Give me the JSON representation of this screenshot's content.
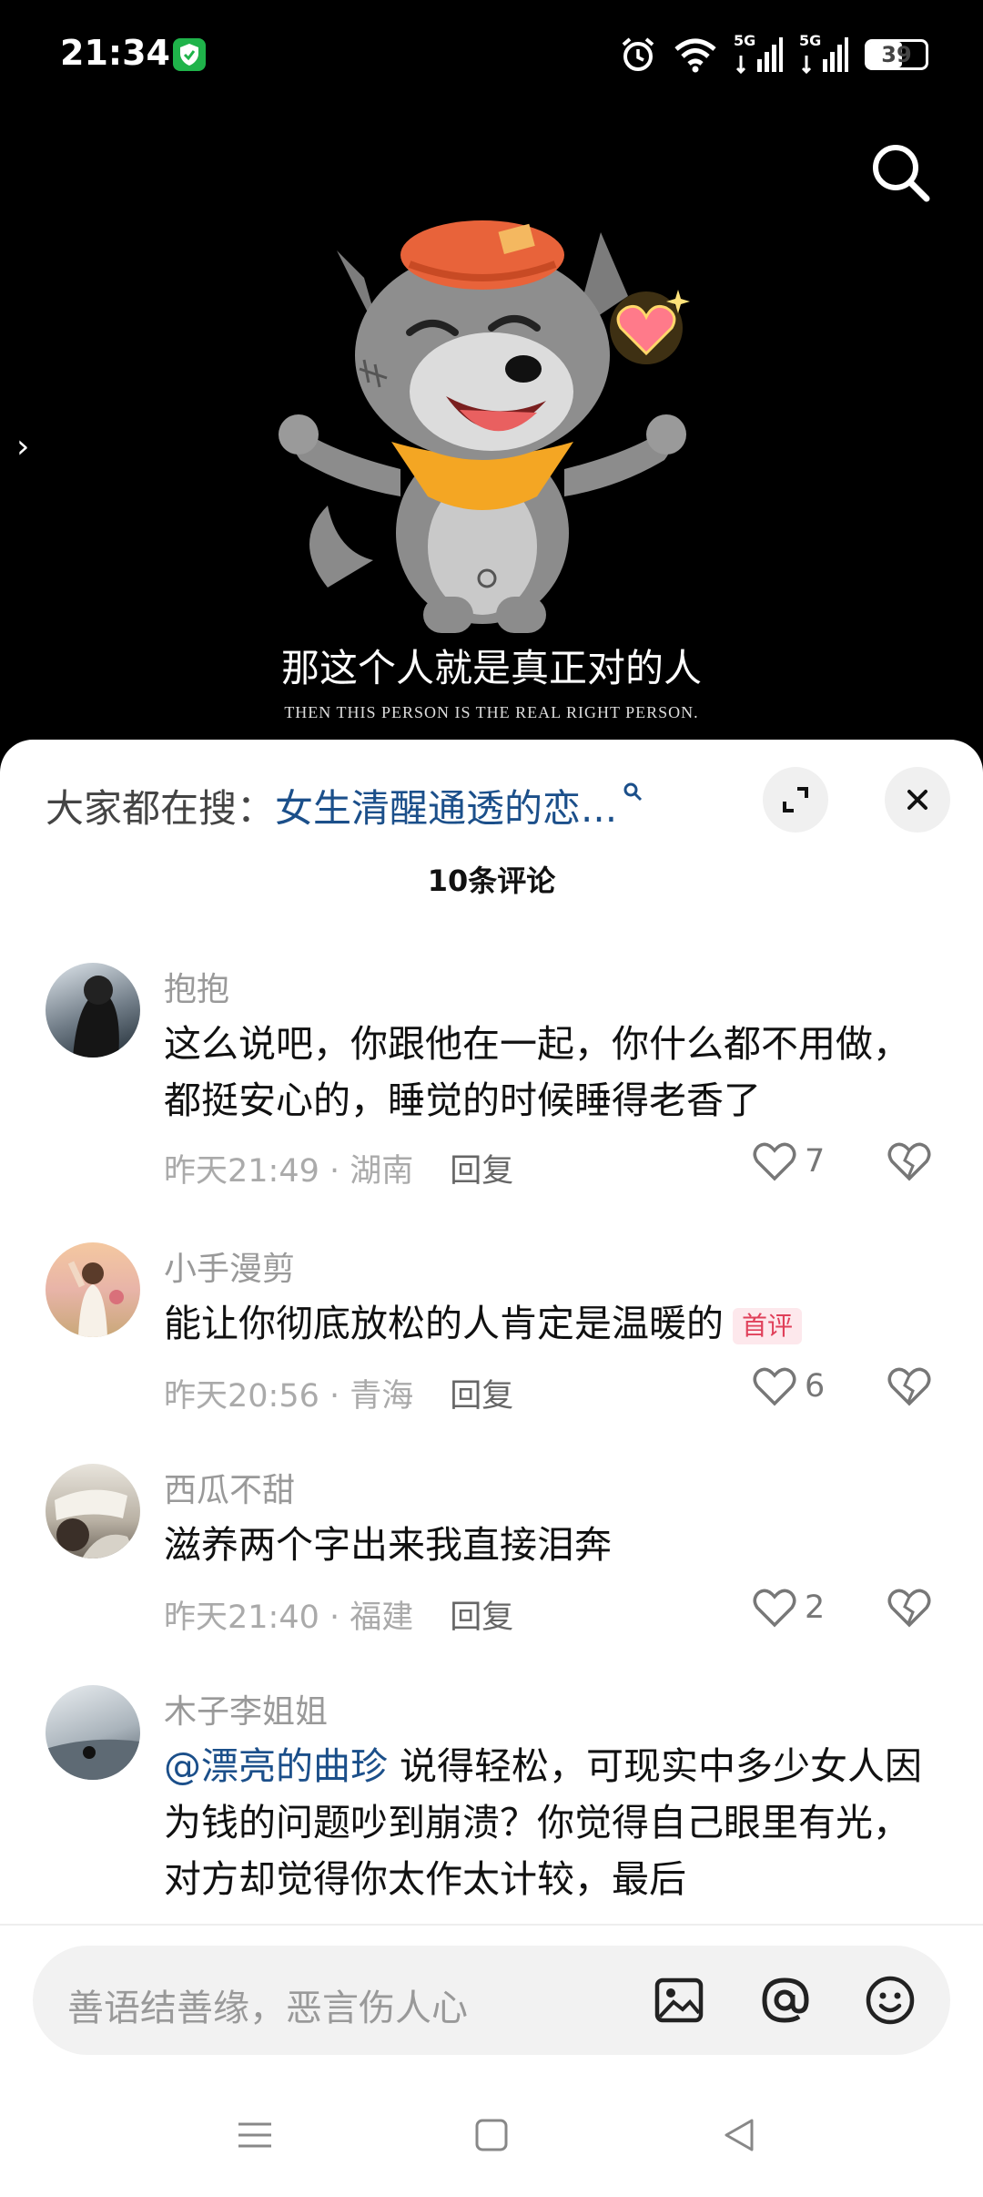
{
  "status": {
    "time": "21:34",
    "battery": "39",
    "net1": "5G",
    "net2": "5G"
  },
  "video": {
    "caption_cn": "那这个人就是真正对的人",
    "caption_en": "THEN THIS PERSON IS THE REAL RIGHT PERSON."
  },
  "sheet": {
    "hot_prefix": "大家都在搜：",
    "hot_term": "女生清醒通透的恋...",
    "count_title": "10条评论"
  },
  "comments": [
    {
      "user": "抱抱",
      "text": "这么说吧，你跟他在一起，你什么都不用做，都挺安心的，睡觉的时候睡得老香了",
      "meta": "昨天21:49 · 湖南",
      "reply": "回复",
      "likes": "7"
    },
    {
      "user": "小手漫剪",
      "text": "能让你彻底放松的人肯定是温暖的",
      "tag": "首评",
      "meta": "昨天20:56 · 青海",
      "reply": "回复",
      "likes": "6"
    },
    {
      "user": "西瓜不甜",
      "text": "滋养两个字出来我直接泪奔",
      "meta": "昨天21:40 · 福建",
      "reply": "回复",
      "likes": "2"
    },
    {
      "user": "木子李姐姐",
      "mention": "@漂亮的曲珍",
      "text": " 说得轻松，可现实中多少女人因为钱的问题吵到崩溃？你觉得自己眼里有光，对方却觉得你太作太计较，最后"
    }
  ],
  "input": {
    "placeholder": "善语结善缘，恶言伤人心"
  },
  "colors": {
    "link": "#1b4f8a",
    "tag_bg": "#fde8ec",
    "tag_fg": "#e0405a"
  }
}
